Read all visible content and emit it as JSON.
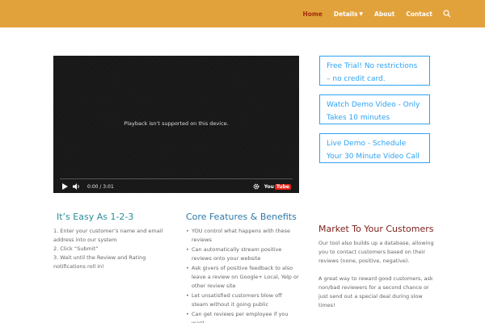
{
  "nav": {
    "items": [
      {
        "label": "Home",
        "active": true,
        "has_dropdown": false
      },
      {
        "label": "Details",
        "active": false,
        "has_dropdown": true
      },
      {
        "label": "About",
        "active": false,
        "has_dropdown": false
      },
      {
        "label": "Contact",
        "active": false,
        "has_dropdown": false
      }
    ],
    "search_icon": "search-icon",
    "dropdown_icon": "chevron-down-icon"
  },
  "colors": {
    "header": "#e2a23b",
    "active_nav": "#a12e0c",
    "cta": "#2ea3f2",
    "heading_teal": "#2a8b98",
    "heading_blue": "#2d7aa8",
    "heading_red": "#7a1f1a"
  },
  "video": {
    "message": "Playback isn't supported on this device.",
    "time": "0:00 / 3:01",
    "logo_text": "You",
    "logo_tube": "Tube",
    "icons": [
      "play-icon",
      "volume-icon",
      "settings-icon",
      "youtube-logo"
    ]
  },
  "cta": {
    "trial": "Free Trial! No restrictions – no credit card.",
    "demo_video": "Watch Demo Video - Only Takes 10 minutes",
    "live_demo": "Live Demo - Schedule Your 30 Minute Video Call"
  },
  "easy": {
    "title": "It’s Easy As 1-2-3",
    "steps": [
      "1. Enter your customer’s name and email address into our system",
      "2. Click “Submit”",
      "3. Wait until the Review and Rating notifications roll in!"
    ]
  },
  "features": {
    "title": "Core Features & Benefits",
    "items": [
      "YOU control what happens with these reviews",
      "Can automatically stream positive reviews onto your website",
      "Ask givers of positive feedback to also leave a review on Google+ Local, Yelp or other review site",
      "Let unsatisfied customers blow off steam without it going public",
      "Can get reviews per employee if you want"
    ]
  },
  "market": {
    "title": "Market To Your Customers",
    "paragraphs": [
      "Our tool also builds up a database, allowing you to contact customers based on their reviews (none, positive, negative).",
      "A great way to reward good customers, ask non/bad reviewers for a second chance or just send out a special deal during slow times!"
    ]
  }
}
